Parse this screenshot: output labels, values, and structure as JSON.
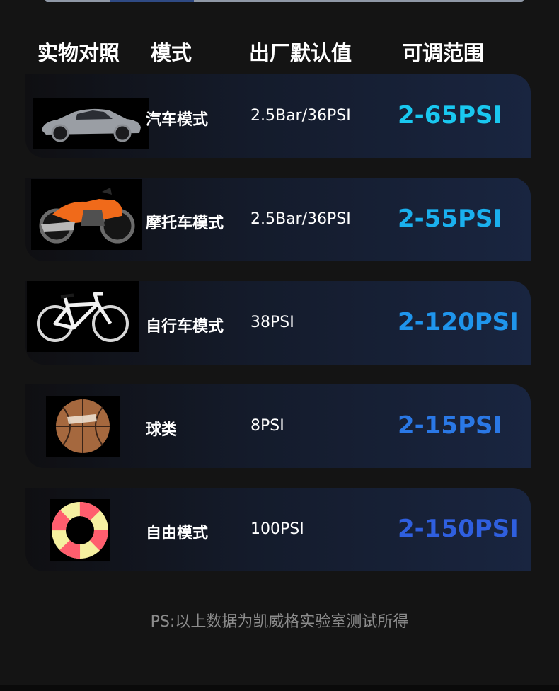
{
  "header": {
    "col_object": "实物对照",
    "col_mode": "模式",
    "col_default": "出厂默认值",
    "col_range": "可调范围"
  },
  "rows": [
    {
      "icon": "car-icon",
      "mode": "汽车模式",
      "default": "2.5Bar/36PSI",
      "range": "2-65PSI",
      "range_color": "#19c8f0"
    },
    {
      "icon": "motorcycle-icon",
      "mode": "摩托车模式",
      "default": "2.5Bar/36PSI",
      "range": "2-55PSI",
      "range_color": "#1ab0ee"
    },
    {
      "icon": "bicycle-icon",
      "mode": "自行车模式",
      "default": "38PSI",
      "range": "2-120PSI",
      "range_color": "#1f95ec"
    },
    {
      "icon": "basketball-icon",
      "mode": "球类",
      "default": "8PSI",
      "range": "2-15PSI",
      "range_color": "#2a78e6"
    },
    {
      "icon": "swim-ring-icon",
      "mode": "自由模式",
      "default": "100PSI",
      "range": "2-150PSI",
      "range_color": "#2f5fdf"
    }
  ],
  "footer": "PS:以上数据为凯威格实验室测试所得"
}
